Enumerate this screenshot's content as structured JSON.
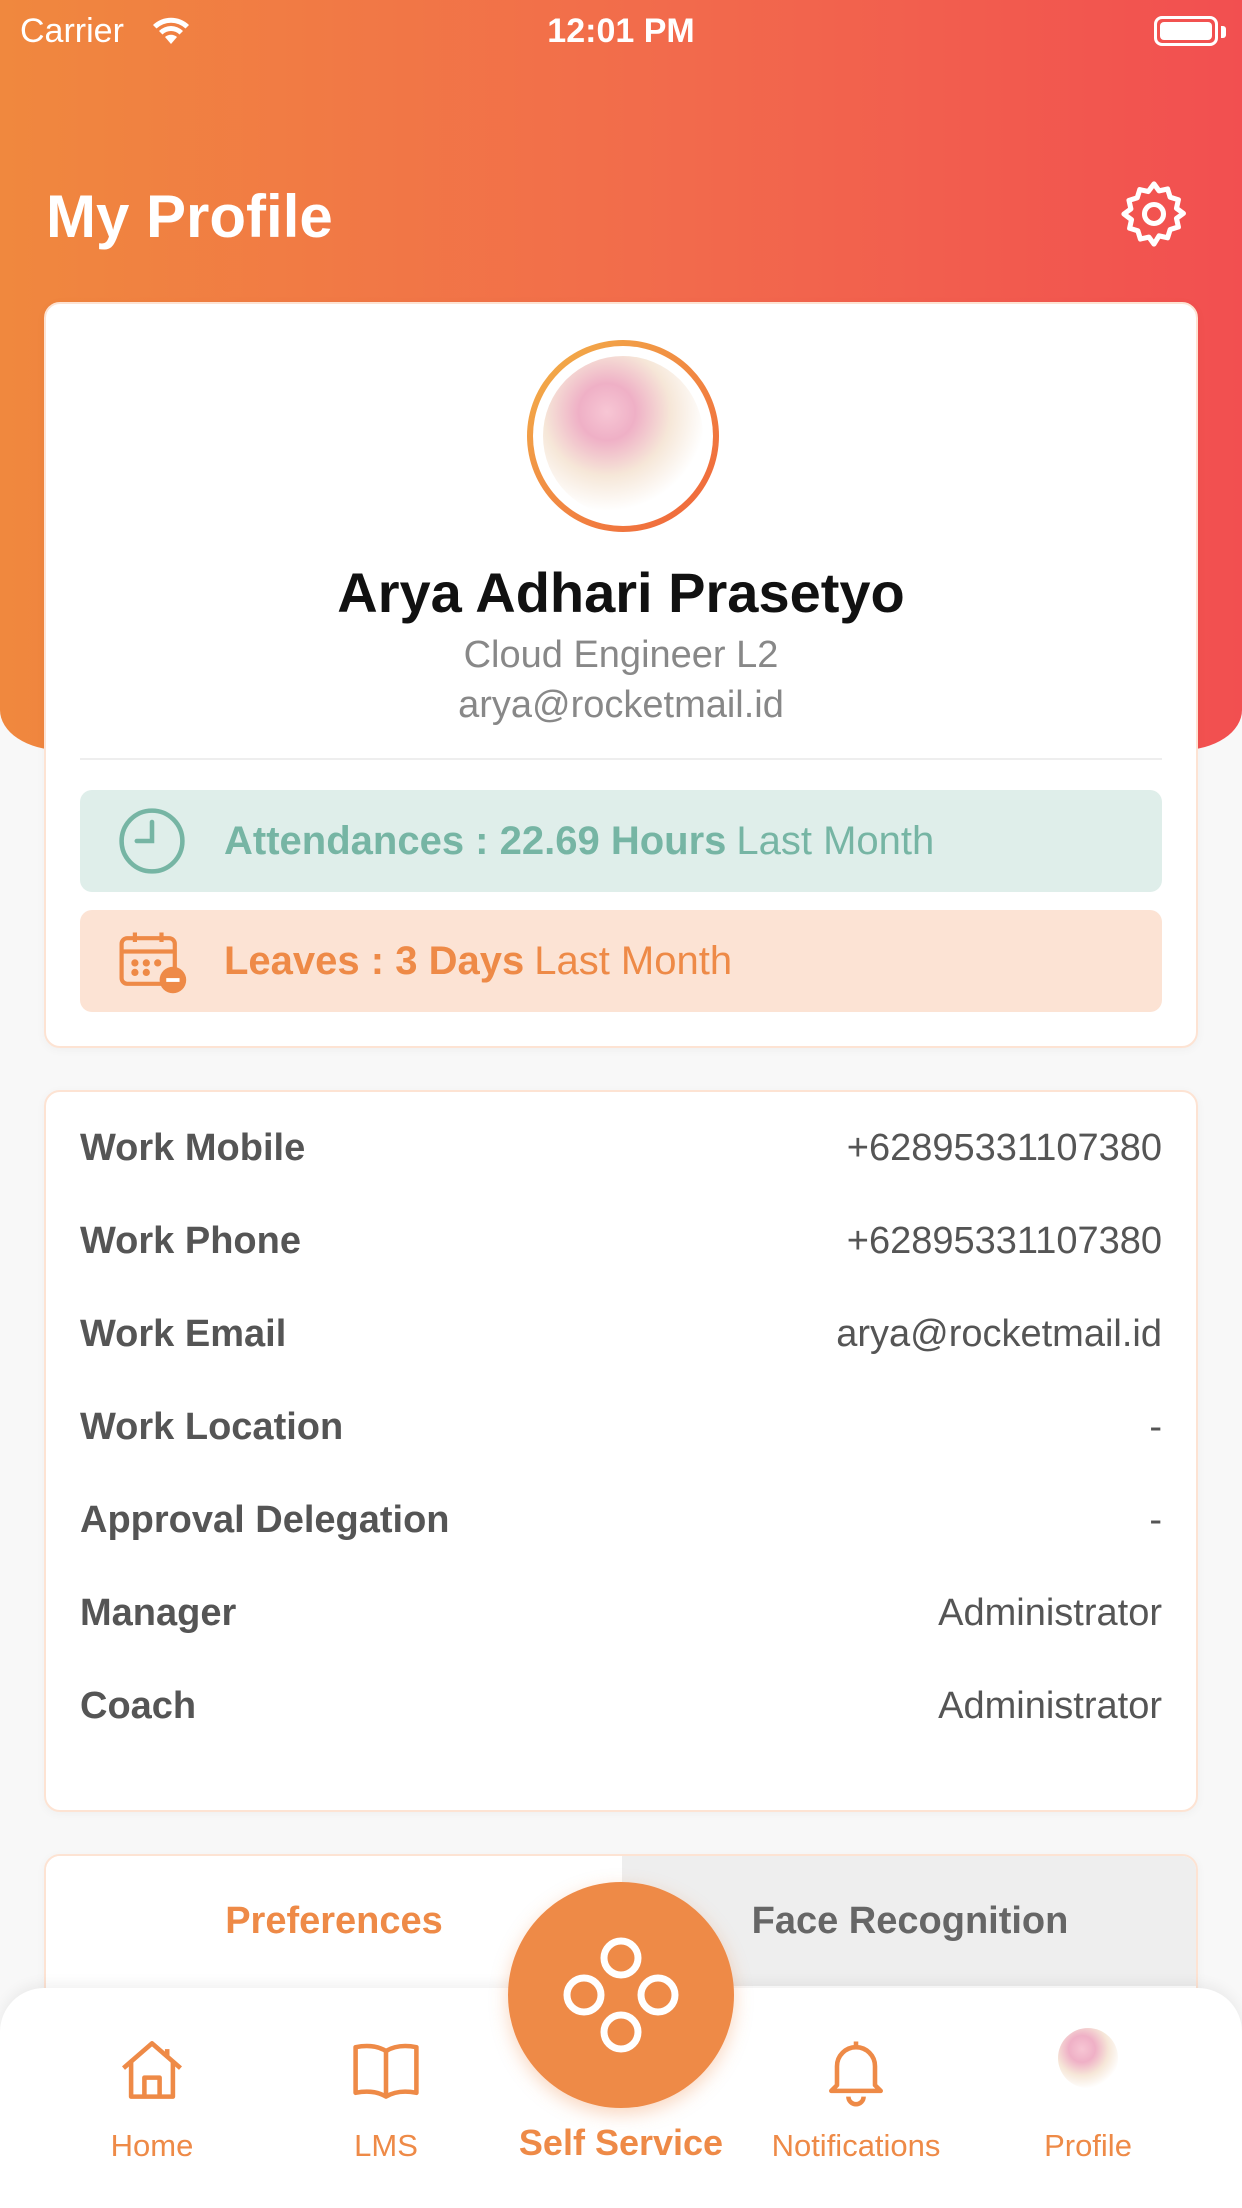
{
  "status_bar": {
    "carrier": "Carrier",
    "time": "12:01 PM"
  },
  "header": {
    "title": "My Profile"
  },
  "profile": {
    "name": "Arya Adhari Prasetyo",
    "role": "Cloud Engineer L2",
    "email": "arya@rocketmail.id"
  },
  "stats": {
    "attendance": {
      "label": "Attendances : 22.69 Hours",
      "suffix": "Last Month"
    },
    "leaves": {
      "label": "Leaves : 3 Days",
      "suffix": "Last Month"
    }
  },
  "info": {
    "rows": [
      {
        "label": "Work Mobile",
        "value": "+62895331107380"
      },
      {
        "label": "Work Phone",
        "value": "+62895331107380"
      },
      {
        "label": "Work Email",
        "value": "arya@rocketmail.id"
      },
      {
        "label": "Work Location",
        "value": "-"
      },
      {
        "label": "Approval Delegation",
        "value": "-"
      },
      {
        "label": "Manager",
        "value": "Administrator"
      },
      {
        "label": "Coach",
        "value": "Administrator"
      }
    ]
  },
  "tabs": {
    "preferences": "Preferences",
    "face_recognition": "Face Recognition"
  },
  "bottom_nav": {
    "home": "Home",
    "lms": "LMS",
    "self_service": "Self Service",
    "notifications": "Notifications",
    "profile": "Profile"
  },
  "colors": {
    "accent": "#ee8a47",
    "header_gradient_start": "#f0883e",
    "header_gradient_end": "#f24f50",
    "attendance_bg": "#dfeeea",
    "attendance_text": "#76b5a4",
    "leave_bg": "#fce3d4"
  }
}
